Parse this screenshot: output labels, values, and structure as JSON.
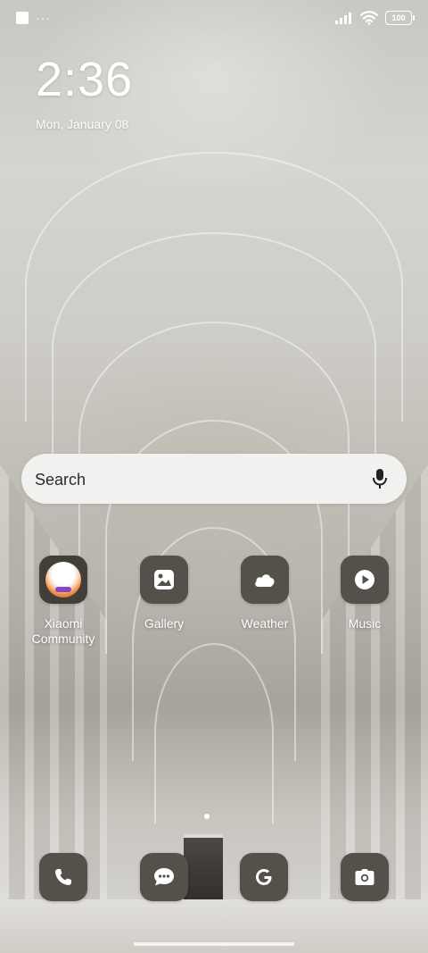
{
  "status_bar": {
    "left_icons": [
      "notification-square-icon",
      "more-notifications-icon"
    ],
    "more_glyph": "···",
    "battery": "100",
    "right_icons": [
      "signal-icon",
      "wifi-icon",
      "battery-icon"
    ]
  },
  "lockscreen": {
    "time": "2:36",
    "date": "Mon, January 08"
  },
  "search": {
    "placeholder": "Search",
    "icon": "mic-icon"
  },
  "apps": [
    {
      "label": "Xiaomi Community",
      "icon": "xiaomi-community-icon"
    },
    {
      "label": "Gallery",
      "icon": "gallery-icon"
    },
    {
      "label": "Weather",
      "icon": "weather-icon"
    },
    {
      "label": "Music",
      "icon": "music-icon"
    }
  ],
  "dock": [
    {
      "label": "Phone",
      "icon": "phone-icon"
    },
    {
      "label": "Messages",
      "icon": "message-icon"
    },
    {
      "label": "Chrome/Google",
      "icon": "google-icon"
    },
    {
      "label": "Camera",
      "icon": "camera-icon"
    }
  ],
  "colors": {
    "icon_bg": "#55504a",
    "search_bg": "#f1f1f0",
    "text": "#ffffff"
  }
}
